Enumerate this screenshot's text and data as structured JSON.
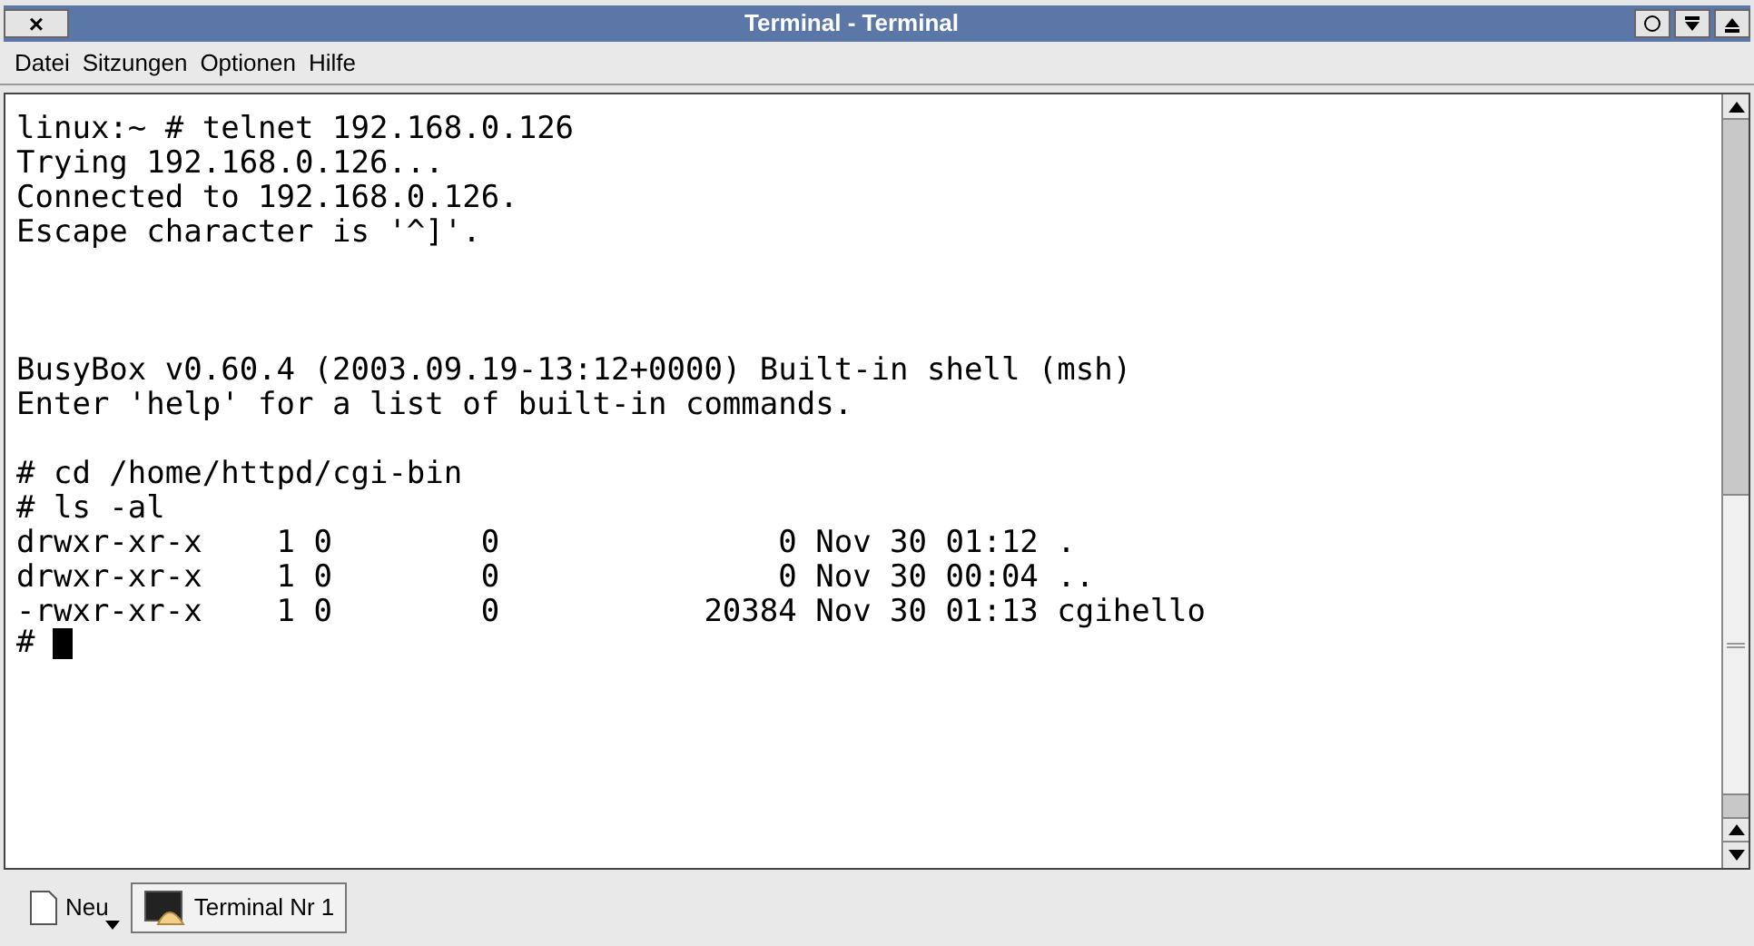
{
  "window": {
    "title": "Terminal - Terminal",
    "close_glyph": "×"
  },
  "menu": [
    "Datei",
    "Sitzungen",
    "Optionen",
    "Hilfe"
  ],
  "terminal": {
    "lines": [
      {
        "kind": "text",
        "text": "linux:~ # telnet 192.168.0.126"
      },
      {
        "kind": "text",
        "text": "Trying 192.168.0.126..."
      },
      {
        "kind": "text",
        "text": "Connected to 192.168.0.126."
      },
      {
        "kind": "text",
        "text": "Escape character is '^]'."
      },
      {
        "kind": "blank"
      },
      {
        "kind": "blank"
      },
      {
        "kind": "blank"
      },
      {
        "kind": "text",
        "text": "BusyBox v0.60.4 (2003.09.19-13:12+0000) Built-in shell (msh)"
      },
      {
        "kind": "text",
        "text": "Enter 'help' for a list of built-in commands."
      },
      {
        "kind": "blank"
      },
      {
        "kind": "text",
        "text": "# cd /home/httpd/cgi-bin"
      },
      {
        "kind": "text",
        "text": "# ls -al"
      },
      {
        "kind": "text",
        "text": "drwxr-xr-x    1 0        0               0 Nov 30 01:12 ."
      },
      {
        "kind": "text",
        "text": "drwxr-xr-x    1 0        0               0 Nov 30 00:04 .."
      },
      {
        "kind": "text",
        "text": "-rwxr-xr-x    1 0        0           20384 Nov 30 01:13 cgihello"
      },
      {
        "kind": "prompt",
        "text": "#"
      }
    ]
  },
  "taskbar": {
    "new_button": "Neu",
    "tasks": [
      {
        "label": "Terminal Nr 1",
        "selected": true
      }
    ]
  }
}
